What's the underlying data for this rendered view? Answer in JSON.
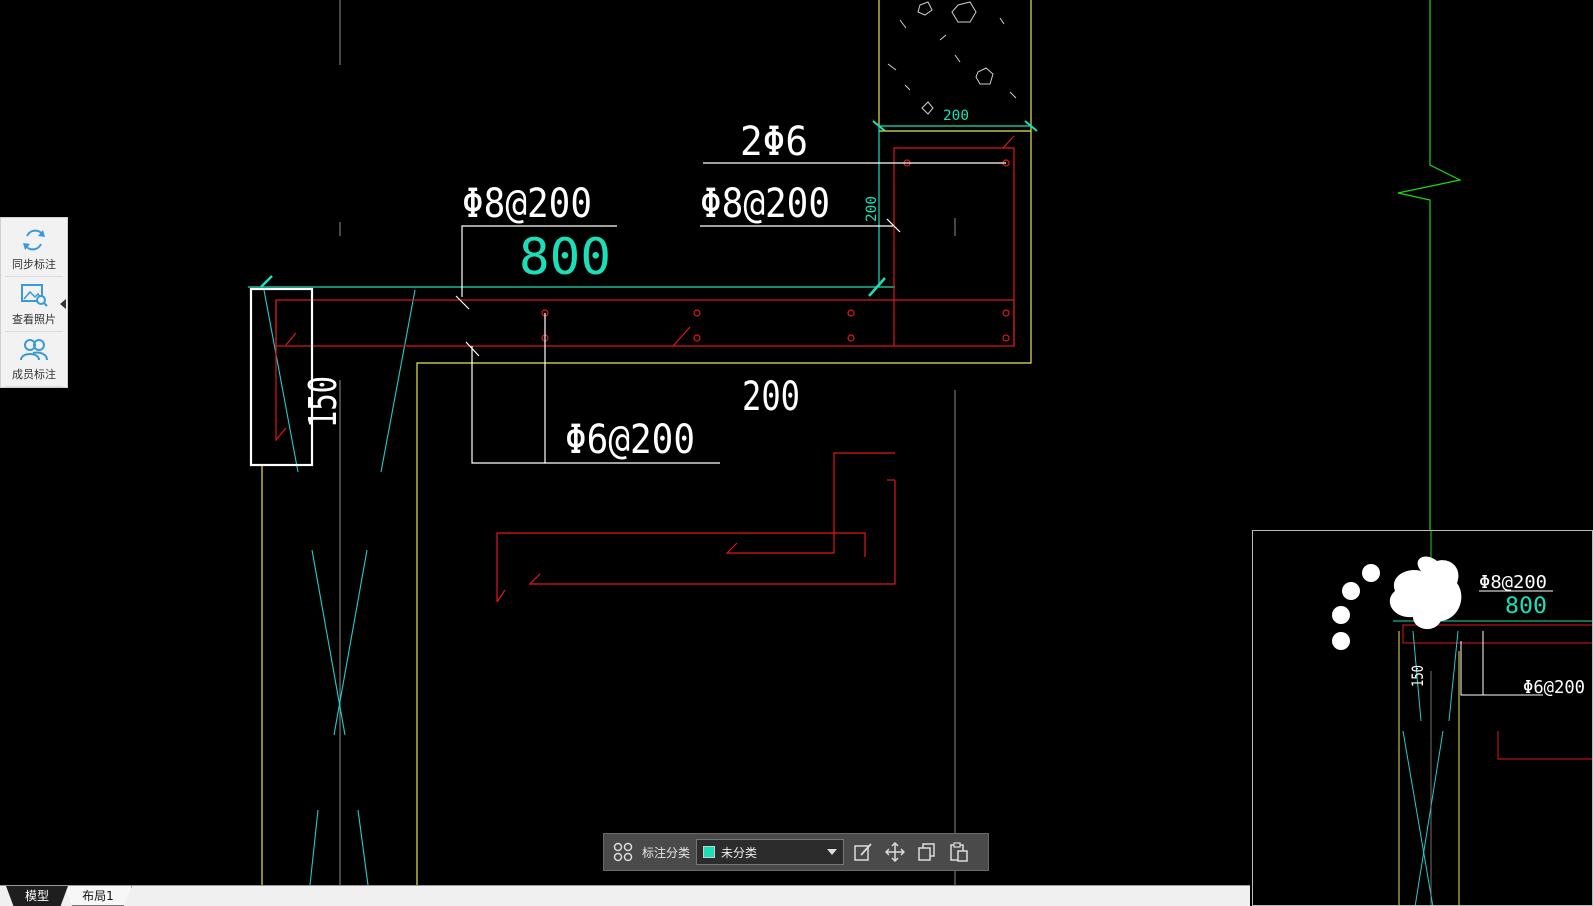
{
  "drawing": {
    "labels": {
      "top_bar_2phi6": "2Φ6",
      "phi8_at200_left": "Φ8@200",
      "phi8_at200_right": "Φ8@200",
      "dim_800": "800",
      "dim_200_top_hatch": "200",
      "dim_200_vertical": "200",
      "dim_200_mid": "200",
      "dim_150": "150",
      "phi6_at200": "Φ6@200"
    },
    "colors": {
      "cyan": "#19e0b8",
      "yellow": "#e8e84a",
      "red": "#e01818",
      "white": "#ffffff",
      "gray": "#8c8c8c",
      "green": "#18d818",
      "light_cyan": "#22cccc"
    }
  },
  "minimap": {
    "labels": {
      "phi8_at200": "Φ8@200",
      "dim_800": "800",
      "dim_150": "150",
      "phi6_at200": "Φ6@200"
    }
  },
  "side_panel": {
    "items": [
      {
        "label": "同步标注",
        "icon": "sync-icon"
      },
      {
        "label": "查看照片",
        "icon": "photo-search-icon"
      },
      {
        "label": "成员标注",
        "icon": "members-icon"
      }
    ]
  },
  "anno_toolbar": {
    "label": "标注分类",
    "selected_category": "未分类",
    "swatch_color": "#19e0b8",
    "icons": [
      "grid-icon",
      "edit-icon",
      "move-icon",
      "copy-icon",
      "paste-icon"
    ]
  },
  "tabs": {
    "model": "模型",
    "layout1": "布局1"
  }
}
